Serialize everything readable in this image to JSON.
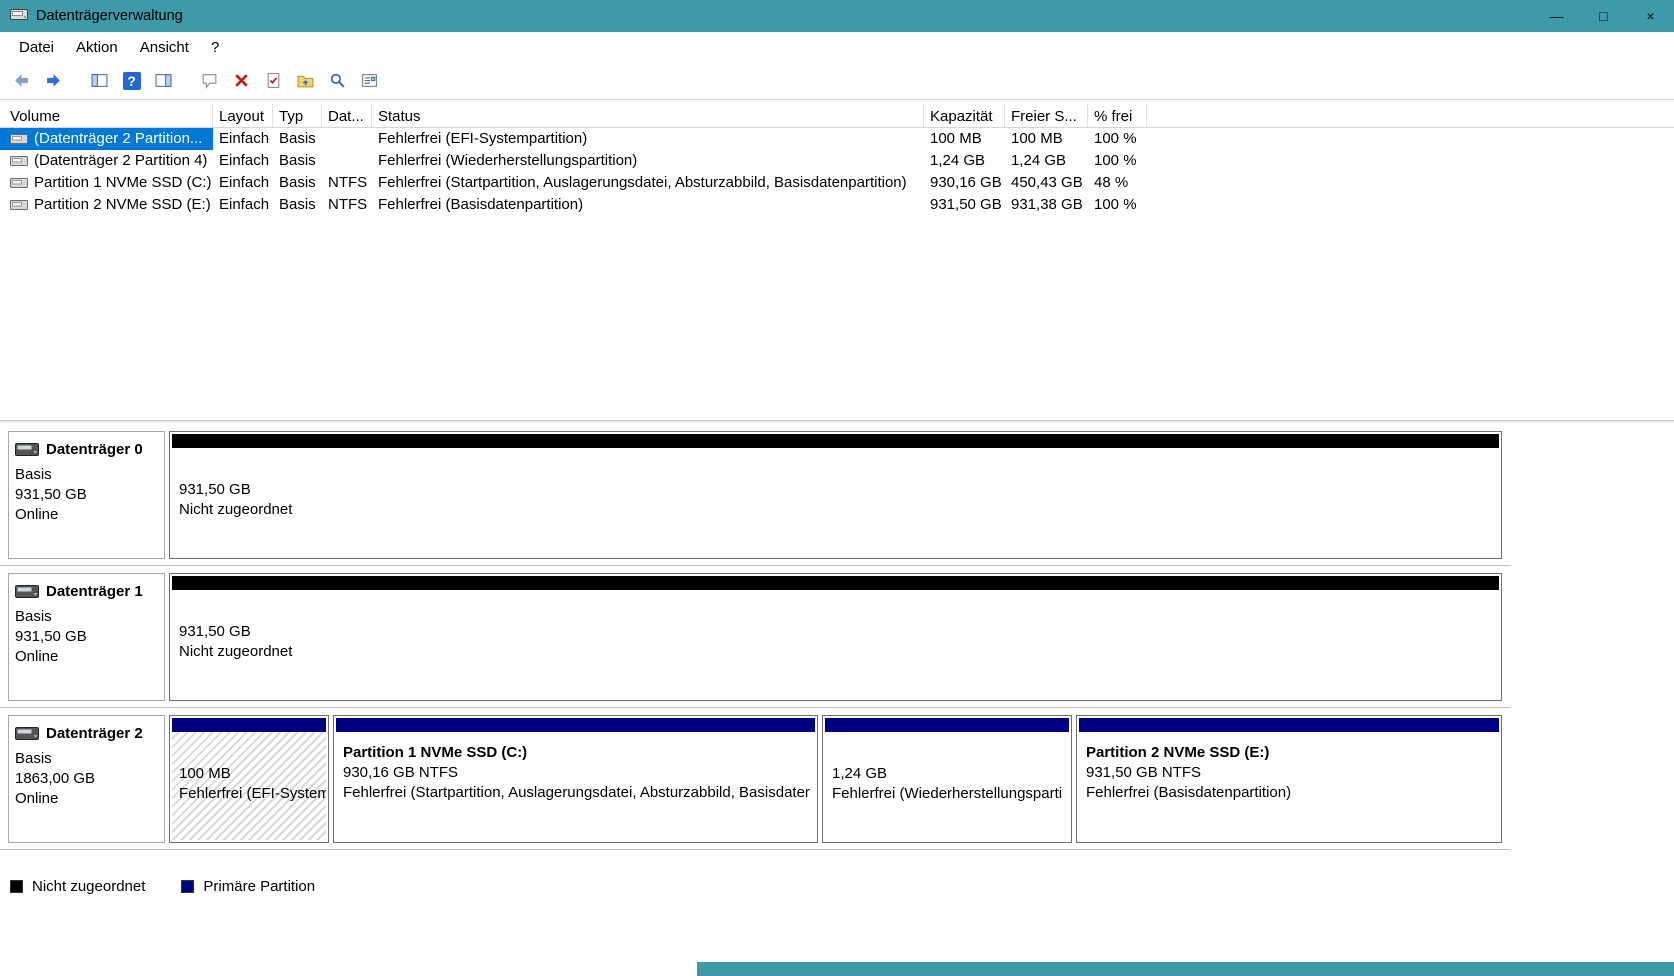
{
  "colors": {
    "titlebar": "#3E99A9",
    "selection": "#0078D7",
    "unallocated": "#000000",
    "primary_partition": "#000082"
  },
  "window": {
    "title": "Datenträgerverwaltung",
    "minimize_glyph": "—",
    "maximize_glyph": "□",
    "close_glyph": "×"
  },
  "menubar": {
    "items": [
      "Datei",
      "Aktion",
      "Ansicht",
      "?"
    ]
  },
  "toolbar": {
    "icons": [
      "back",
      "forward",
      "show-console-tree",
      "help",
      "show-action-pane",
      "comment",
      "delete-volume",
      "task-check",
      "folder-open",
      "search",
      "properties"
    ]
  },
  "volume_list": {
    "columns": {
      "volume": "Volume",
      "layout": "Layout",
      "typ": "Typ",
      "dateisystem": "Dat...",
      "status": "Status",
      "kapazitaet": "Kapazität",
      "freier_speicher": "Freier S...",
      "prozent_frei": "% frei"
    },
    "rows": [
      {
        "volume": "(Datenträger 2 Partition...",
        "layout": "Einfach",
        "typ": "Basis",
        "dateisystem": "",
        "status": "Fehlerfrei (EFI-Systempartition)",
        "kapazitaet": "100 MB",
        "freier_speicher": "100 MB",
        "prozent_frei": "100 %",
        "selected": true
      },
      {
        "volume": "(Datenträger 2 Partition 4)",
        "layout": "Einfach",
        "typ": "Basis",
        "dateisystem": "",
        "status": "Fehlerfrei (Wiederherstellungspartition)",
        "kapazitaet": "1,24 GB",
        "freier_speicher": "1,24 GB",
        "prozent_frei": "100 %",
        "selected": false
      },
      {
        "volume": "Partition 1 NVMe SSD (C:)",
        "layout": "Einfach",
        "typ": "Basis",
        "dateisystem": "NTFS",
        "status": "Fehlerfrei (Startpartition, Auslagerungsdatei, Absturzabbild, Basisdatenpartition)",
        "kapazitaet": "930,16 GB",
        "freier_speicher": "450,43 GB",
        "prozent_frei": "48 %",
        "selected": false
      },
      {
        "volume": "Partition 2 NVMe SSD (E:)",
        "layout": "Einfach",
        "typ": "Basis",
        "dateisystem": "NTFS",
        "status": "Fehlerfrei (Basisdatenpartition)",
        "kapazitaet": "931,50 GB",
        "freier_speicher": "931,38 GB",
        "prozent_frei": "100 %",
        "selected": false
      }
    ]
  },
  "disks": [
    {
      "name": "Datenträger 0",
      "type": "Basis",
      "size": "931,50 GB",
      "status": "Online",
      "partitions": [
        {
          "title": "",
          "size": "931,50 GB",
          "status": "Nicht zugeordnet",
          "kind": "unallocated"
        }
      ]
    },
    {
      "name": "Datenträger 1",
      "type": "Basis",
      "size": "931,50 GB",
      "status": "Online",
      "partitions": [
        {
          "title": "",
          "size": "931,50 GB",
          "status": "Nicht zugeordnet",
          "kind": "unallocated"
        }
      ]
    },
    {
      "name": "Datenträger 2",
      "type": "Basis",
      "size": "1863,00 GB",
      "status": "Online",
      "partitions": [
        {
          "title": "",
          "size": "100 MB",
          "status": "Fehlerfrei (EFI-System",
          "kind": "primary-selected"
        },
        {
          "title": "Partition 1 NVMe SSD  (C:)",
          "size": "930,16 GB NTFS",
          "status": "Fehlerfrei (Startpartition, Auslagerungsdatei, Absturzabbild, Basisdater",
          "kind": "primary"
        },
        {
          "title": "",
          "size": "1,24 GB",
          "status": "Fehlerfrei (Wiederherstellungsparti",
          "kind": "primary"
        },
        {
          "title": "Partition 2 NVMe SSD  (E:)",
          "size": "931,50 GB NTFS",
          "status": "Fehlerfrei (Basisdatenpartition)",
          "kind": "primary"
        }
      ]
    }
  ],
  "legend": {
    "unallocated": "Nicht zugeordnet",
    "primary": "Primäre Partition"
  }
}
